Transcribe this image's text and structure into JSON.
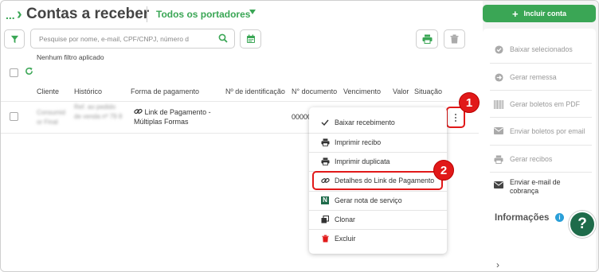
{
  "header": {
    "breadcrumb_dots": "...",
    "title": "Contas a receber",
    "portadores": "Todos os portadores"
  },
  "toolbar": {
    "search_placeholder": "Pesquise por nome, e-mail, CPF/CNPJ, número d",
    "no_filter": "Nenhum filtro aplicado"
  },
  "table": {
    "headers": [
      "Cliente",
      "Histórico",
      "Forma de pagamento",
      "Nº de identificação",
      "N° documento",
      "Vencimento",
      "Valor",
      "Situação"
    ],
    "row": {
      "cliente": "Consumid or Final",
      "historico": "Ref. ao pedido de venda nº 79 8",
      "forma_pagamento_line1": "Link de Pagamento -",
      "forma_pagamento_line2": "Múltiplas Formas",
      "documento": "00000"
    }
  },
  "row_menu": {
    "items": [
      {
        "label": "Baixar recebimento",
        "icon": "check-icon"
      },
      {
        "label": "Imprimir recibo",
        "icon": "printer-icon"
      },
      {
        "label": "Imprimir duplicata",
        "icon": "printer-icon"
      },
      {
        "label": "Detalhes do Link de Pagamento",
        "icon": "link-icon"
      },
      {
        "label": "Gerar nota de serviço",
        "icon": "n-icon"
      },
      {
        "label": "Clonar",
        "icon": "clone-icon"
      },
      {
        "label": "Excluir",
        "icon": "trash-icon"
      }
    ]
  },
  "annotations": {
    "badge1": "1",
    "badge2": "2"
  },
  "right_panel": {
    "include_button": "Incluir conta",
    "actions": [
      {
        "label": "Baixar selecionados",
        "icon": "check-circle-icon"
      },
      {
        "label": "Gerar remessa",
        "icon": "arrow-circle-icon"
      },
      {
        "label": "Gerar boletos em PDF",
        "icon": "barcode-icon"
      },
      {
        "label": "Enviar boletos por email",
        "icon": "envelope-icon"
      },
      {
        "label": "Gerar recibos",
        "icon": "printer-icon"
      },
      {
        "label": "Enviar e-mail de cobrança",
        "icon": "envelope-icon"
      }
    ],
    "info_title": "Informações",
    "info_badge": "i",
    "help_label": "?"
  },
  "colors": {
    "brand_green": "#3aa655",
    "annotation_red": "#e11919",
    "help_green": "#1e6b4a",
    "info_blue": "#2a9fd8"
  }
}
